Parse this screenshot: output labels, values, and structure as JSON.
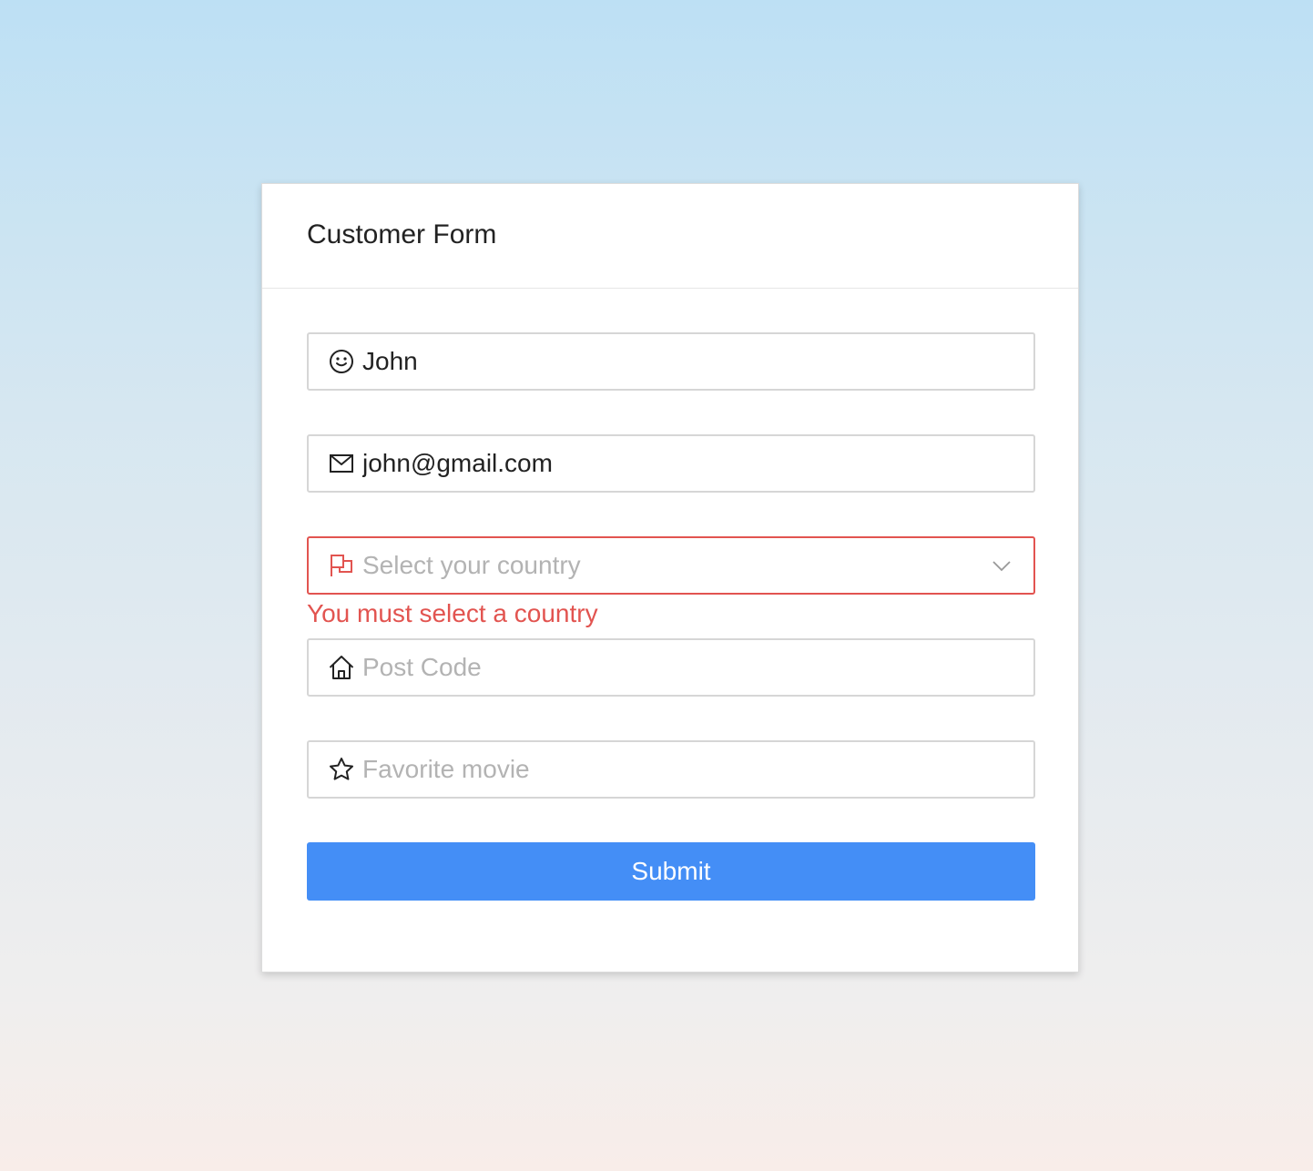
{
  "form": {
    "title": "Customer Form",
    "name": {
      "value": "John",
      "icon": "smile-icon"
    },
    "email": {
      "value": "john@gmail.com",
      "icon": "mail-icon"
    },
    "country": {
      "placeholder": "Select your country",
      "value": "",
      "icon": "flag-icon",
      "error": "You must select a country"
    },
    "postcode": {
      "placeholder": "Post Code",
      "value": "",
      "icon": "home-icon"
    },
    "movie": {
      "placeholder": "Favorite movie",
      "value": "",
      "icon": "star-icon"
    },
    "submit_label": "Submit"
  },
  "colors": {
    "accent": "#448ef6",
    "error": "#e25450",
    "border": "#d6d6d6",
    "text": "#222222",
    "placeholder": "#b3b3b3"
  }
}
